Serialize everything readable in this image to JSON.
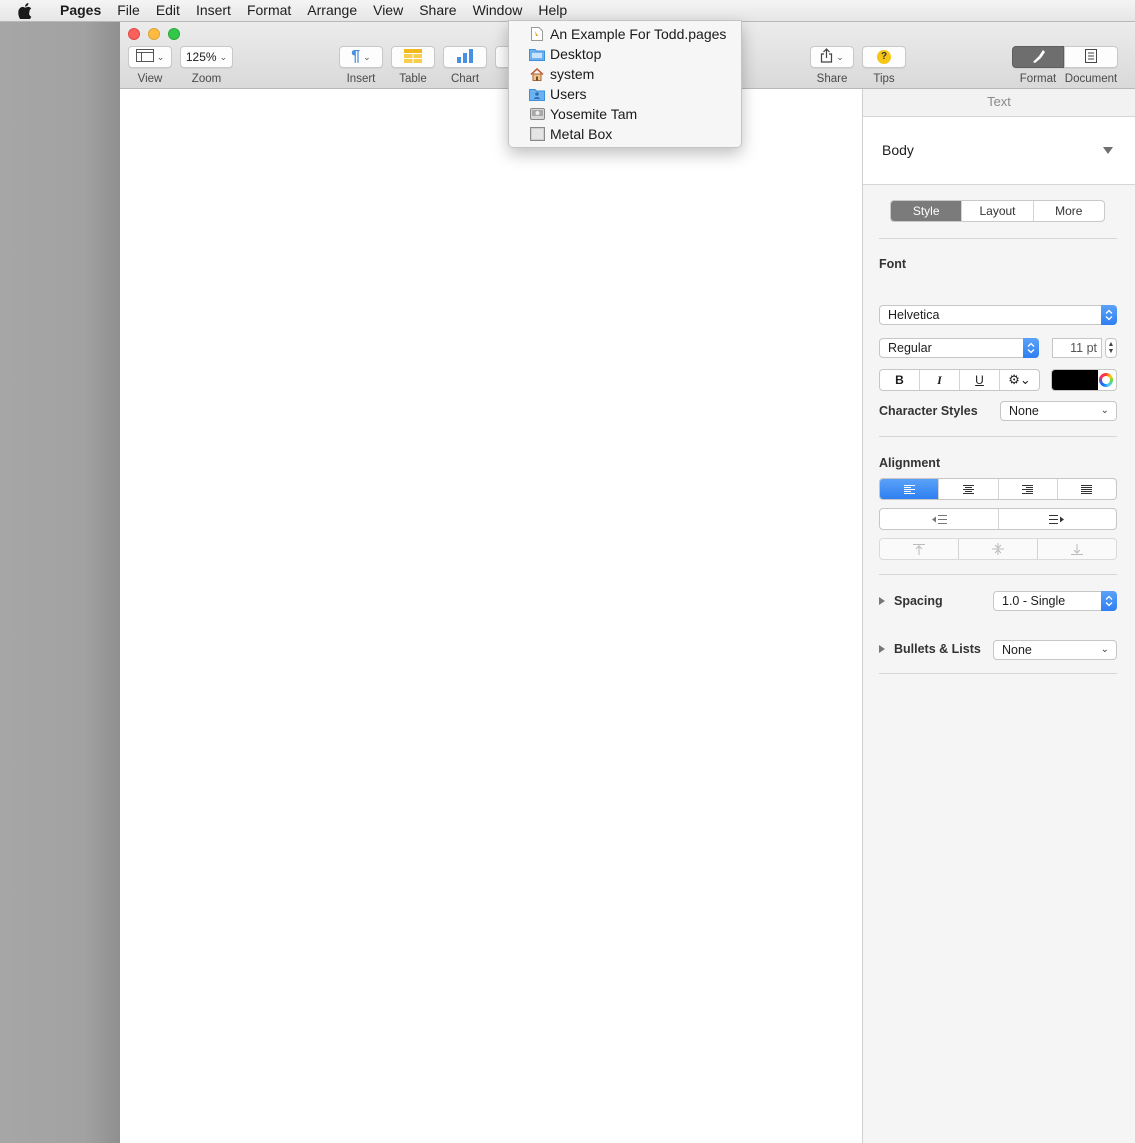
{
  "menubar": {
    "app_name": "Pages",
    "items": [
      "File",
      "Edit",
      "Insert",
      "Format",
      "Arrange",
      "View",
      "Share",
      "Window",
      "Help"
    ]
  },
  "toolbar": {
    "view_label": "View",
    "zoom_value": "125%",
    "zoom_label": "Zoom",
    "insert_label": "Insert",
    "table_label": "Table",
    "chart_label": "Chart",
    "share_label": "Share",
    "tips_label": "Tips",
    "format_label": "Format",
    "document_label": "Document"
  },
  "window_menu": {
    "items": [
      {
        "label": "An Example For Todd.pages",
        "icon": "pages-document-icon"
      },
      {
        "label": "Desktop",
        "icon": "folder-icon"
      },
      {
        "label": "system",
        "icon": "home-icon"
      },
      {
        "label": "Users",
        "icon": "users-folder-icon"
      },
      {
        "label": "Yosemite Tam",
        "icon": "hard-drive-icon"
      },
      {
        "label": "Metal Box",
        "icon": "disk-icon"
      }
    ]
  },
  "inspector": {
    "header": "Text",
    "paragraph_style": "Body",
    "tabs": [
      "Style",
      "Layout",
      "More"
    ],
    "selected_tab": "Style",
    "font": {
      "label": "Font",
      "family": "Helvetica",
      "typeface": "Regular",
      "size": "11 pt",
      "buttons": [
        "B",
        "I",
        "U"
      ],
      "color": "#000000"
    },
    "character_styles": {
      "label": "Character Styles",
      "value": "None"
    },
    "alignment": {
      "label": "Alignment",
      "selected": "left"
    },
    "spacing": {
      "label": "Spacing",
      "value": "1.0 - Single"
    },
    "bullets": {
      "label": "Bullets & Lists",
      "value": "None"
    }
  },
  "colors": {
    "accent_blue": "#2f7ff2",
    "selected_segment": "#7b7b7b"
  }
}
